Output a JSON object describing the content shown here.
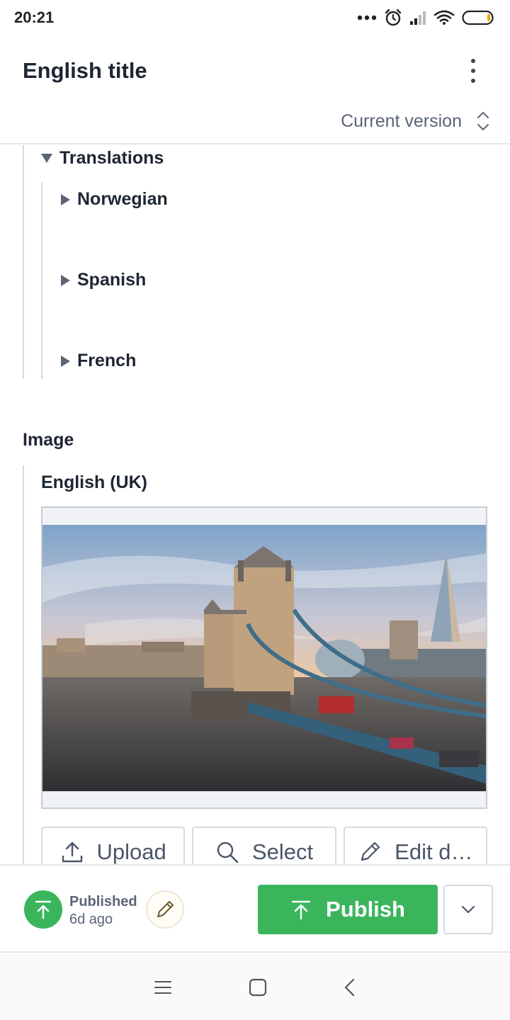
{
  "status_bar": {
    "time": "20:21"
  },
  "header": {
    "title": "English title"
  },
  "version": {
    "label": "Current version"
  },
  "translations": {
    "label": "Translations",
    "items": [
      {
        "label": "Norwegian"
      },
      {
        "label": "Spanish"
      },
      {
        "label": "French"
      }
    ]
  },
  "image_section": {
    "label": "Image",
    "language": "English (UK)",
    "buttons": {
      "upload": "Upload",
      "select": "Select",
      "edit": "Edit d…"
    }
  },
  "footer": {
    "status": "Published",
    "time_ago": "6d ago",
    "publish_label": "Publish"
  },
  "colors": {
    "accent_green": "#3ab55c",
    "text_dark": "#1e2633",
    "text_muted": "#5a6577"
  }
}
